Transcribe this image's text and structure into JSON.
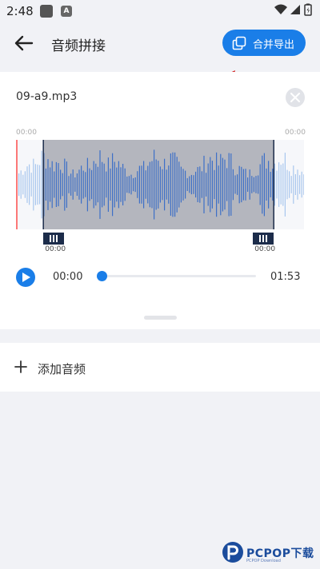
{
  "status_bar": {
    "time": "2:48",
    "app_icon_letter": "A"
  },
  "header": {
    "title": "音频拼接",
    "export_label": "合并导出"
  },
  "track": {
    "file_name": "09-a9.mp3",
    "timeline_start": "00:00",
    "timeline_end": "00:00",
    "handle_left_time": "00:00",
    "handle_right_time": "00:00",
    "selection_start_fraction": 0.095,
    "selection_end_fraction": 0.895
  },
  "player": {
    "current_time": "00:00",
    "total_time": "01:53",
    "progress": 0.0
  },
  "add_audio_label": "添加音频",
  "watermark": {
    "text": "PCPOP下载",
    "subtext": "PCPOP Download"
  },
  "colors": {
    "accent": "#1a7ee8",
    "background": "#f1f2f6",
    "selection_fill": "#b4b6be",
    "waveform": "#3d6fc7",
    "waveform_light": "#a8c6ee",
    "handle": "#1c2c4a",
    "arrow": "#d21f1f"
  }
}
